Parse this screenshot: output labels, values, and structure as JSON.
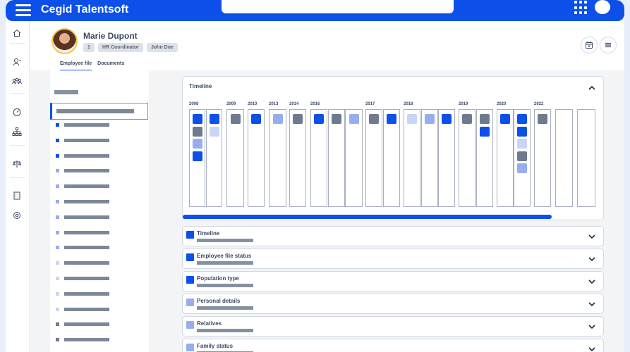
{
  "app": {
    "title": "Cegid Talentsoft"
  },
  "icons": {
    "menu": "hamburger-icon",
    "apps": "app-grid-icon",
    "calendar": "calendar-icon",
    "list": "list-icon",
    "chevron_up": "chevron-up-icon",
    "chevron_down": "chevron-down-icon"
  },
  "colors": {
    "primary": "#0c50e9",
    "dark_block": "#6e7a8e",
    "mid_block": "#98adf0",
    "light_block": "#c9d5f6",
    "background": "#e9eefb"
  },
  "nav": {
    "items": [
      "home-icon",
      "user-settings-icon",
      "team-icon",
      "dashboard-icon",
      "org-chart-icon",
      "scales-icon",
      "building-icon",
      "settings-icon"
    ]
  },
  "profile": {
    "name": "Marie Dupont",
    "chips": [
      "1",
      "HR Coordinator",
      "John Doe"
    ],
    "tabs": [
      {
        "label": "Employee file",
        "active": true
      },
      {
        "label": "Documents",
        "active": false
      }
    ]
  },
  "sidebar": {
    "items": [
      {
        "color": "#0c50e9"
      },
      {
        "color": "#0c50e9"
      },
      {
        "color": "#0c50e9"
      },
      {
        "color": "#98adf0"
      },
      {
        "color": "#98adf0"
      },
      {
        "color": "#98adf0"
      },
      {
        "color": "#98adf0"
      },
      {
        "color": "#98adf0"
      },
      {
        "color": "#98adf0"
      },
      {
        "color": "#c9d5f6"
      },
      {
        "color": "#c9d5f6"
      },
      {
        "color": "#c9d5f6"
      },
      {
        "color": "#c9d5f6"
      },
      {
        "color": "#6e7a8e"
      },
      {
        "color": "#6e7a8e"
      }
    ]
  },
  "timeline": {
    "title": "Timeline",
    "progress": 0.89,
    "year_labels": [
      {
        "label": "2008",
        "col": 0
      },
      {
        "label": "2009",
        "col": 2
      },
      {
        "label": "2010",
        "col": 3
      },
      {
        "label": "2013",
        "col": 4
      },
      {
        "label": "2014",
        "col": 5
      },
      {
        "label": "2016",
        "col": 6
      },
      {
        "label": "2017",
        "col": 9
      },
      {
        "label": "2018",
        "col": 11
      },
      {
        "label": "2019",
        "col": 14
      },
      {
        "label": "2020",
        "col": 16
      },
      {
        "label": "2022",
        "col": 18
      }
    ],
    "columns": [
      [
        "b",
        "d",
        "m",
        "b"
      ],
      [
        "b",
        "l"
      ],
      [
        "d"
      ],
      [
        "b"
      ],
      [
        "m"
      ],
      [
        "d"
      ],
      [
        "b"
      ],
      [
        "d"
      ],
      [
        "m"
      ],
      [
        "d"
      ],
      [
        "b"
      ],
      [
        "l"
      ],
      [
        "m"
      ],
      [
        "b"
      ],
      [
        "d"
      ],
      [
        "d",
        "b"
      ],
      [
        "b"
      ],
      [
        "b",
        "b",
        "l",
        "d",
        "m"
      ],
      [
        "d"
      ],
      [],
      []
    ]
  },
  "sections": [
    {
      "label": "Timeline",
      "color": "#0c50e9"
    },
    {
      "label": "Employee file status",
      "color": "#0c50e9"
    },
    {
      "label": "Population type",
      "color": "#0c50e9"
    },
    {
      "label": "Personal details",
      "color": "#98adf0"
    },
    {
      "label": "Relatives",
      "color": "#98adf0"
    },
    {
      "label": "Family status",
      "color": "#98adf0"
    }
  ]
}
